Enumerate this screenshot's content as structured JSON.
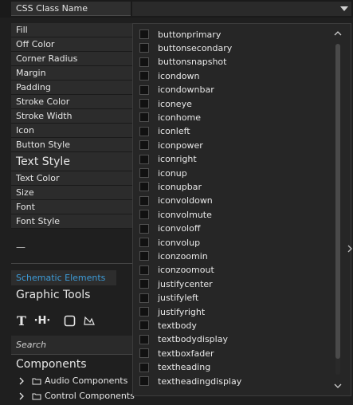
{
  "header": {
    "title": "CSS Class Name",
    "dropdown_arrow_icon": "chevron-down-icon"
  },
  "properties": [
    {
      "label": "Fill"
    },
    {
      "label": "Off Color"
    },
    {
      "label": "Corner Radius"
    },
    {
      "label": "Margin"
    },
    {
      "label": "Padding"
    },
    {
      "label": "Stroke Color"
    },
    {
      "label": "Stroke Width"
    },
    {
      "label": "Icon"
    },
    {
      "label": "Button Style"
    },
    {
      "label": "Text Style"
    },
    {
      "label": "Text Color"
    },
    {
      "label": "Size"
    },
    {
      "label": "Font"
    },
    {
      "label": "Font Style"
    }
  ],
  "dash": "—",
  "tabs": {
    "schematic": "Schematic Elements"
  },
  "graphic_tools": {
    "title": "Graphic Tools",
    "tools": [
      {
        "name": "text-tool",
        "glyph": "T"
      },
      {
        "name": "line-tool",
        "glyph": "·H·"
      },
      {
        "name": "rectangle-tool",
        "glyph": ""
      },
      {
        "name": "polygon-tool",
        "glyph": ""
      }
    ]
  },
  "search": {
    "placeholder": "Search"
  },
  "components": {
    "title": "Components",
    "items": [
      {
        "label": "Audio Components"
      },
      {
        "label": "Control Components"
      }
    ]
  },
  "dropdown_options": [
    "buttonprimary",
    "buttonsecondary",
    "buttonsnapshot",
    "icondown",
    "icondownbar",
    "iconeye",
    "iconhome",
    "iconleft",
    "iconpower",
    "iconright",
    "iconup",
    "iconupbar",
    "iconvoldown",
    "iconvolmute",
    "iconvoloff",
    "iconvolup",
    "iconzoomin",
    "iconzoomout",
    "justifycenter",
    "justifyleft",
    "justifyright",
    "textbody",
    "textbodydisplay",
    "textboxfader",
    "textheading",
    "textheadingdisplay"
  ],
  "colors": {
    "background": "#1f1f1f",
    "accent": "#3d9bd7",
    "text": "#e6e6e6"
  }
}
